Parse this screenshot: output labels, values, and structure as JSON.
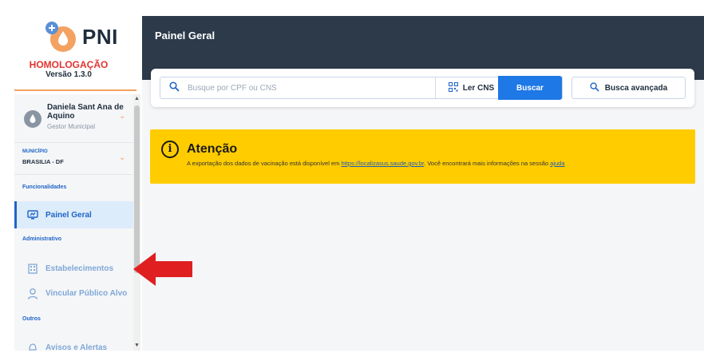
{
  "sidebar": {
    "brand": "PNI",
    "environment": "HOMOLOGAÇÃO",
    "version": "Versão 1.3.0",
    "user": {
      "name": "Daniela Sant Ana de Aquino",
      "role": "Gestor Municipal"
    },
    "municipio": {
      "label": "MUNICÍPIO",
      "value": "BRASILIA - DF"
    },
    "sections": [
      {
        "label": "Funcionalidades",
        "items": [
          {
            "label": "Painel Geral",
            "icon": "dashboard-icon",
            "active": true
          }
        ]
      },
      {
        "label": "Administrativo",
        "items": [
          {
            "label": "Estabelecimentos",
            "icon": "building-icon",
            "active": false
          },
          {
            "label": "Vincular Público Alvo",
            "icon": "user-link-icon",
            "active": false
          }
        ]
      },
      {
        "label": "Outros",
        "items": [
          {
            "label": "Avisos e Alertas",
            "icon": "bell-icon",
            "active": false
          }
        ]
      }
    ]
  },
  "header": {
    "title": "Painel Geral"
  },
  "search": {
    "placeholder": "Busque por CPF ou CNS",
    "ler_cns_label": "Ler CNS",
    "buscar_label": "Buscar",
    "busca_avancada_label": "Busca avançada"
  },
  "alert": {
    "title": "Atenção",
    "text_before": "A exportação dos dados de vacinação está disponível em",
    "link_url_text": "https://localizasus.saude.gov.br",
    "text_middle": "Você encontrará mais informações na sessão",
    "link_help_text": "ajuda"
  },
  "colors": {
    "accent": "#1e64c8",
    "brand_orange": "#f4a261",
    "header_bg": "#2c3a4a",
    "alert_bg": "#ffcc00",
    "env_red": "#e3342f",
    "annotation_arrow": "#e02020"
  }
}
